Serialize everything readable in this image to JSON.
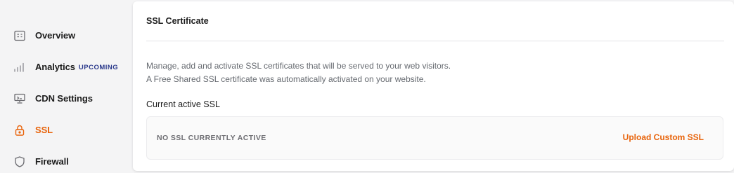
{
  "sidebar": {
    "items": [
      {
        "label": "Overview",
        "icon": "overview-icon",
        "active": false
      },
      {
        "label": "Analytics",
        "badge": "UPCOMING",
        "icon": "analytics-bars-icon",
        "active": false
      },
      {
        "label": "CDN Settings",
        "icon": "cdn-monitor-icon",
        "active": false
      },
      {
        "label": "SSL",
        "icon": "lock-icon",
        "active": true
      },
      {
        "label": "Firewall",
        "icon": "shield-icon",
        "active": false
      }
    ]
  },
  "main": {
    "title": "SSL Certificate",
    "description_line1": "Manage, add and activate SSL certificates that will be served to your web visitors.",
    "description_line2": "A Free Shared SSL certificate was automatically activated on your website.",
    "current_label": "Current active SSL",
    "status": "NO SSL CURRENTLY ACTIVE",
    "upload_label": "Upload Custom SSL"
  },
  "colors": {
    "accent": "#e8630a",
    "badge": "#2b3a8c",
    "muted_text": "#666a70",
    "background": "#f4f4f5"
  }
}
